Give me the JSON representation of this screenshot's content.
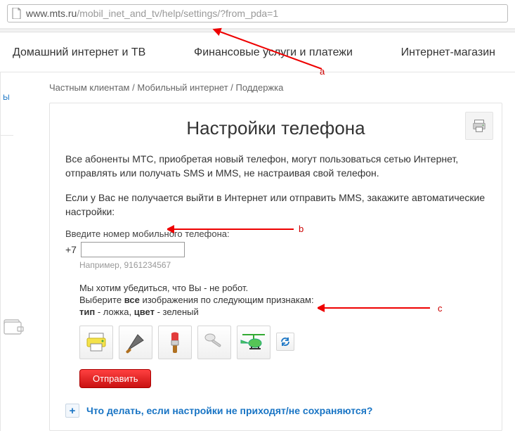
{
  "url": {
    "host": "www.mts.ru",
    "path": "/mobil_inet_and_tv/help/settings/?from_pda=1"
  },
  "nav": {
    "item1": "Домашний интернет и ТВ",
    "item2": "Финансовые услуги и платежи",
    "item3": "Интернет-магазин"
  },
  "breadcrumb": {
    "a": "Частным клиентам",
    "b": "Мобильный интернет",
    "c": "Поддержка",
    "sep": " / "
  },
  "title": "Настройки телефона",
  "para1": "Все абоненты МТС, приобретая новый телефон, могут пользоваться сетью Интернет, отправлять или получать SMS и MMS, не настраивая свой телефон.",
  "para2": "Если у Вас не получается выйти в Интернет или отправить MMS, закажите автоматические настройки:",
  "phone": {
    "label": "Введите номер мобильного телефона:",
    "prefix": "+7",
    "placeholder": "",
    "example": "Например, 9161234567"
  },
  "captcha": {
    "line1": "Мы хотим убедиться, что Вы - не робот.",
    "line2_a": "Выберите ",
    "line2_b": "все",
    "line2_c": " изображения по следующим признакам:",
    "line3_a": "тип",
    "line3_b": " - ложка, ",
    "line3_c": "цвет",
    "line3_d": " - зеленый"
  },
  "submit": "Отправить",
  "accordion": "Что делать, если настройки не приходят/не сохраняются?",
  "annotations": {
    "a": "a",
    "b": "b",
    "c": "c"
  },
  "left_stub": "Ы"
}
